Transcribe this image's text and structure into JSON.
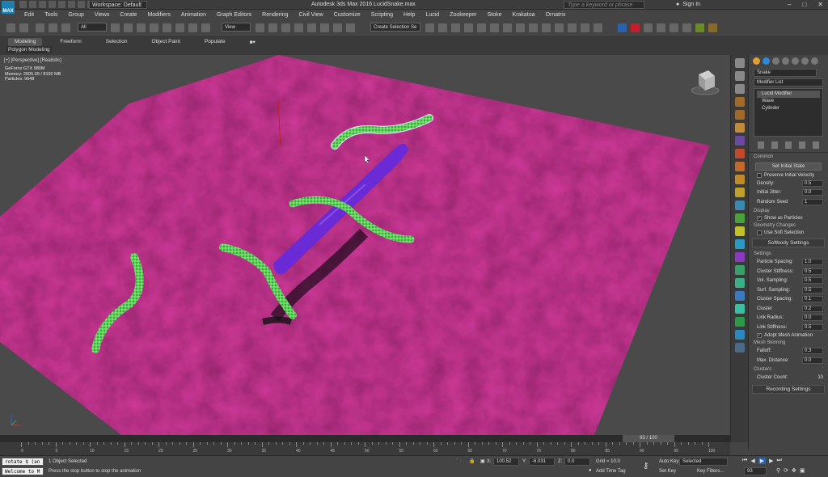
{
  "titlebar": {
    "workspace": "Workspace: Default",
    "title": "Autodesk 3ds Max 2016     LucidSnake.max",
    "search_placeholder": "Type a keyword or phrase",
    "sign_in": "Sign In",
    "logo": "MAX"
  },
  "menubar": {
    "items": [
      "Edit",
      "Tools",
      "Group",
      "Views",
      "Create",
      "Modifiers",
      "Animation",
      "Graph Editors",
      "Rendering",
      "Civil View",
      "Customize",
      "Scripting",
      "Help",
      "Lucid",
      "Zookeeper",
      "Stoke",
      "Krakatoa",
      "Ornatrix"
    ]
  },
  "toolbar": {
    "filter": "All",
    "ref_coord": "View",
    "selection_set": "Create Selection Se"
  },
  "ribbon": {
    "tabs": [
      "Modeling",
      "Freeform",
      "Selection",
      "Object Paint",
      "Populate"
    ],
    "sub": "Polygon Modeling"
  },
  "viewport": {
    "label": "[+] [Perspective] [Realistic]",
    "gpu": "GeForce GTX 980M",
    "memory": "Memory: 2505.99 / 8192 MB",
    "particles": "Particles: 9648"
  },
  "cmdpanel": {
    "object_name": "Snake",
    "modifier_list": "Modifier List",
    "stack": [
      "Lucid Modifier",
      "Wave",
      "Cylinder"
    ],
    "common_header": "Common",
    "set_initial_state": "Set Initial State",
    "preserve_velocity": "Preserve Initial Velocity",
    "density_label": "Density:",
    "density": "0.5",
    "jitter_label": "Initial Jitter:",
    "jitter": "0.0",
    "seed_label": "Random Seed",
    "seed": "1",
    "display_header": "Display",
    "show_particles": "Show as Particles",
    "geom_header": "Geometry Changes",
    "soft_selection": "Use Soft Selection",
    "softbody_rollout": "Softbody Settings",
    "settings_header": "Settings",
    "params": [
      {
        "label": "Particle Spacing:",
        "value": "1.0"
      },
      {
        "label": "Cluster Stiffness:",
        "value": "0.5"
      },
      {
        "label": "Vol. Sampling:",
        "value": "0.5"
      },
      {
        "label": "Surf. Sampling:",
        "value": "0.5"
      },
      {
        "label": "Cluster Spacing:",
        "value": "0.1"
      },
      {
        "label": "Cluster",
        "value": "0.2"
      },
      {
        "label": "Link Radius:",
        "value": "0.0"
      },
      {
        "label": "Link Stiffness:",
        "value": "0.5"
      }
    ],
    "adopt_mesh": "Adopt Mesh Animation",
    "mesh_skinning": "Mesh Skinning",
    "falloff_label": "Falloff:",
    "falloff": "0.3",
    "maxdist_label": "Max. Distance:",
    "maxdist": "0.0",
    "clusters_header": "Clusters",
    "cluster_count": "Cluster Count:",
    "cluster_count_value": "10",
    "recording_rollout": "Recording Settings"
  },
  "timeline": {
    "slider": "93 / 100",
    "ticks": [
      "0",
      "5",
      "10",
      "15",
      "20",
      "25",
      "30",
      "35",
      "40",
      "45",
      "50",
      "55",
      "60",
      "65",
      "70",
      "75",
      "80",
      "85",
      "90",
      "95",
      "100"
    ]
  },
  "status": {
    "maxscript": "rotate $ (an",
    "welcome": "Welcome to M",
    "selected": "1 Object Selected",
    "prompt": "Press the stop button to stop the animation",
    "x_label": "X:",
    "x": "100.52",
    "y_label": "Y:",
    "y": "-6.031",
    "z_label": "Z:",
    "z": "0.0",
    "grid": "Grid = 10.0",
    "add_time_tag": "Add Time Tag",
    "auto_key": "Auto Key",
    "auto_key_value": "Selected",
    "set_key": "Set Key",
    "key_filters": "Key Filters...",
    "frame": "93"
  },
  "colors": {
    "ground": "#d13a9a",
    "snake": "#5fd45a",
    "cylinder": "#6a2ad6"
  }
}
